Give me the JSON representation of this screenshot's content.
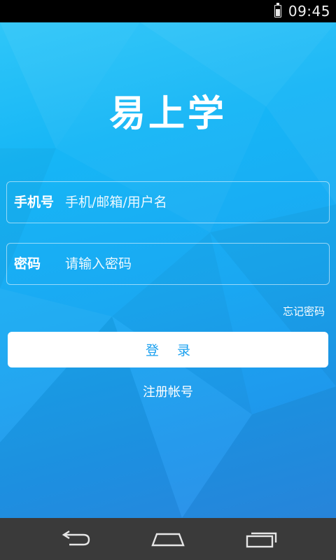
{
  "status_bar": {
    "time": "09:45",
    "battery_icon": "battery-icon",
    "battery_level": 0.8
  },
  "app": {
    "logo_text": "易上学"
  },
  "login_form": {
    "phone_label": "手机号",
    "phone_placeholder": "手机/邮箱/用户名",
    "phone_value": "",
    "password_label": "密码",
    "password_placeholder": "请输入密码",
    "password_value": "",
    "forgot_password": "忘记密码",
    "login_button": "登录",
    "register_link": "注册帐号"
  },
  "nav_bar": {
    "back_icon": "back-icon",
    "home_icon": "home-icon",
    "recents_icon": "recents-icon"
  },
  "colors": {
    "primary_blue": "#1aa8f2",
    "button_text": "#1aa0ef",
    "nav_bar": "#3a3a3a",
    "status_bar": "#000000"
  }
}
